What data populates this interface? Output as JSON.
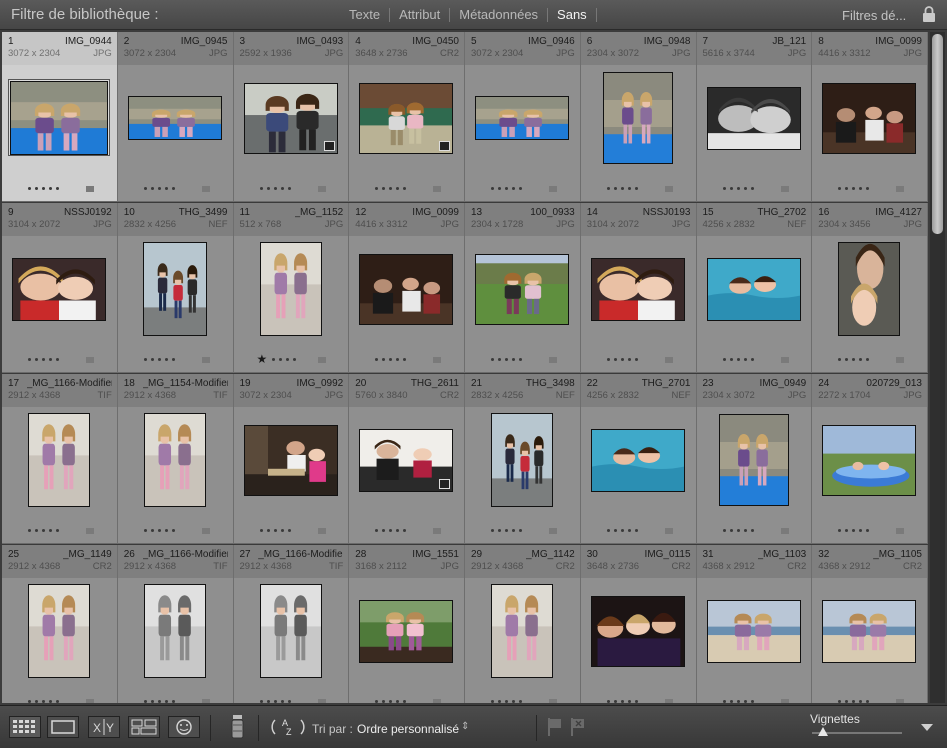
{
  "filter_bar": {
    "title": "Filtre de bibliothèque :",
    "options": [
      "Texte",
      "Attribut",
      "Métadonnées",
      "Sans"
    ],
    "active": "Sans",
    "presets_label": "Filtres dé...",
    "lock_icon": "lock-icon"
  },
  "grid": {
    "cells": [
      {
        "num": "1",
        "name": "IMG_0944",
        "dim": "3072 x 2304",
        "ext": "JPG"
      },
      {
        "num": "2",
        "name": "IMG_0945",
        "dim": "3072 x 2304",
        "ext": "JPG"
      },
      {
        "num": "3",
        "name": "IMG_0493",
        "dim": "2592 x 1936",
        "ext": "JPG"
      },
      {
        "num": "4",
        "name": "IMG_0450",
        "dim": "3648 x 2736",
        "ext": "CR2"
      },
      {
        "num": "5",
        "name": "IMG_0946",
        "dim": "3072 x 2304",
        "ext": "JPG"
      },
      {
        "num": "6",
        "name": "IMG_0948",
        "dim": "2304 x 3072",
        "ext": "JPG"
      },
      {
        "num": "7",
        "name": "JB_121",
        "dim": "5616 x 3744",
        "ext": "JPG"
      },
      {
        "num": "8",
        "name": "IMG_0099",
        "dim": "4416 x 3312",
        "ext": "JPG"
      },
      {
        "num": "9",
        "name": "NSSJ0192",
        "dim": "3104 x 2072",
        "ext": "JPG"
      },
      {
        "num": "10",
        "name": "THG_3499",
        "dim": "2832 x 4256",
        "ext": "NEF"
      },
      {
        "num": "11",
        "name": "_MG_1152",
        "dim": "512 x 768",
        "ext": "JPG"
      },
      {
        "num": "12",
        "name": "IMG_0099",
        "dim": "4416 x 3312",
        "ext": "JPG"
      },
      {
        "num": "13",
        "name": "100_0933",
        "dim": "2304 x 1728",
        "ext": "JPG"
      },
      {
        "num": "14",
        "name": "NSSJ0193",
        "dim": "3104 x 2072",
        "ext": "JPG"
      },
      {
        "num": "15",
        "name": "THG_2702",
        "dim": "4256 x 2832",
        "ext": "NEF"
      },
      {
        "num": "16",
        "name": "IMG_4127",
        "dim": "2304 x 3456",
        "ext": "JPG"
      },
      {
        "num": "17",
        "name": "_MG_1166-Modifier-2",
        "dim": "2912 x 4368",
        "ext": "TIF"
      },
      {
        "num": "18",
        "name": "_MG_1154-Modifier",
        "dim": "2912 x 4368",
        "ext": "TIF"
      },
      {
        "num": "19",
        "name": "IMG_0992",
        "dim": "3072 x 2304",
        "ext": "JPG"
      },
      {
        "num": "20",
        "name": "THG_2611",
        "dim": "5760 x 3840",
        "ext": "CR2"
      },
      {
        "num": "21",
        "name": "THG_3498",
        "dim": "2832 x 4256",
        "ext": "NEF"
      },
      {
        "num": "22",
        "name": "THG_2701",
        "dim": "4256 x 2832",
        "ext": "NEF"
      },
      {
        "num": "23",
        "name": "IMG_0949",
        "dim": "2304 x 3072",
        "ext": "JPG"
      },
      {
        "num": "24",
        "name": "020729_013",
        "dim": "2272 x 1704",
        "ext": "JPG"
      },
      {
        "num": "25",
        "name": "_MG_1149",
        "dim": "2912 x 4368",
        "ext": "CR2"
      },
      {
        "num": "26",
        "name": "_MG_1166-Modifier-4",
        "dim": "2912 x 4368",
        "ext": "TIF"
      },
      {
        "num": "27",
        "name": "_MG_1166-Modifier-3",
        "dim": "2912 x 4368",
        "ext": "TIF"
      },
      {
        "num": "28",
        "name": "IMG_1551",
        "dim": "3168 x 2112",
        "ext": "JPG"
      },
      {
        "num": "29",
        "name": "_MG_1142",
        "dim": "2912 x 4368",
        "ext": "CR2"
      },
      {
        "num": "30",
        "name": "IMG_0115",
        "dim": "3648 x 2736",
        "ext": "CR2"
      },
      {
        "num": "31",
        "name": "_MG_1103",
        "dim": "4368 x 2912",
        "ext": "CR2"
      },
      {
        "num": "32",
        "name": "_MG_1105",
        "dim": "4368 x 2912",
        "ext": "CR2"
      }
    ],
    "selected_index": 0,
    "rated_index": 10,
    "rating_in_rated_cell": 1
  },
  "toolbar": {
    "sort_label": "Tri par :",
    "sort_value": "Ordre personnalisé",
    "thumbnails_label": "Vignettes",
    "thumbnail_size": 0.12
  },
  "colors": {
    "accent_selected": "#cfcfcf",
    "cell_bg": "#8f8f8f",
    "toolbar_bg": "#3f3f3f"
  }
}
